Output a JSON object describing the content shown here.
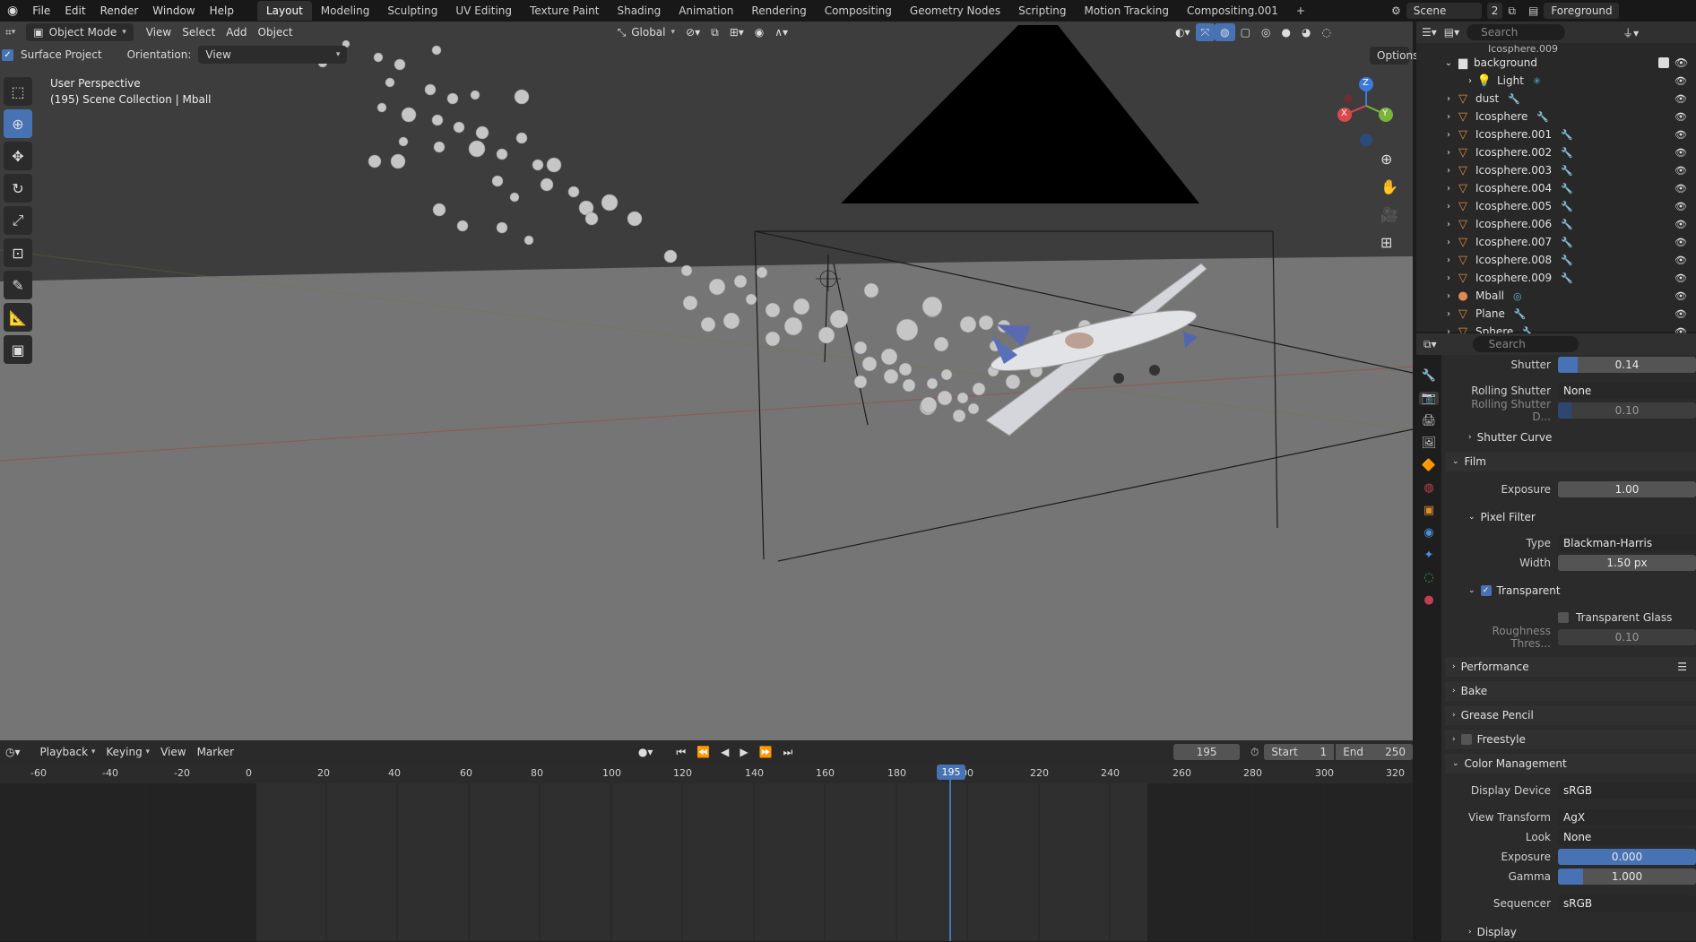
{
  "topbar": {
    "menus": [
      "File",
      "Edit",
      "Render",
      "Window",
      "Help"
    ],
    "workspaces": [
      "Layout",
      "Modeling",
      "Sculpting",
      "UV Editing",
      "Texture Paint",
      "Shading",
      "Animation",
      "Rendering",
      "Compositing",
      "Geometry Nodes",
      "Scripting",
      "Motion Tracking",
      "Compositing.001"
    ],
    "active_workspace": "Layout",
    "add_tab": "+",
    "scene_name": "Scene",
    "scene_count": "2",
    "view_layer": "Foreground"
  },
  "viewport": {
    "mode": "Object Mode",
    "menus": [
      "View",
      "Select",
      "Add",
      "Object"
    ],
    "transform_orientation": "Global",
    "surface_project_label": "Surface Project",
    "orientation_label": "Orientation:",
    "orientation_value": "View",
    "options_label": "Options",
    "overlay_title": "User Perspective",
    "overlay_subtitle": "(195) Scene Collection | Mball",
    "gizmo_labels": {
      "z": "Z",
      "y": "Y",
      "x": "X"
    }
  },
  "outliner": {
    "search_placeholder": "Search",
    "partial_top": "Icosphere.009",
    "collection": "background",
    "items": [
      {
        "name": "Light",
        "type": "light"
      },
      {
        "name": "dust",
        "type": "mesh"
      },
      {
        "name": "Icosphere",
        "type": "mesh"
      },
      {
        "name": "Icosphere.001",
        "type": "mesh"
      },
      {
        "name": "Icosphere.002",
        "type": "mesh"
      },
      {
        "name": "Icosphere.003",
        "type": "mesh"
      },
      {
        "name": "Icosphere.004",
        "type": "mesh"
      },
      {
        "name": "Icosphere.005",
        "type": "mesh"
      },
      {
        "name": "Icosphere.006",
        "type": "mesh"
      },
      {
        "name": "Icosphere.007",
        "type": "mesh"
      },
      {
        "name": "Icosphere.008",
        "type": "mesh"
      },
      {
        "name": "Icosphere.009",
        "type": "mesh"
      },
      {
        "name": "Mball",
        "type": "meta"
      },
      {
        "name": "Plane",
        "type": "mesh"
      },
      {
        "name": "Sphere",
        "type": "mesh"
      }
    ]
  },
  "properties": {
    "search_placeholder": "Search",
    "shutter_label": "Shutter",
    "shutter_value": "0.14",
    "shutter_fill": 0.14,
    "rolling_shutter_label": "Rolling Shutter",
    "rolling_shutter_value": "None",
    "rolling_duration_label": "Rolling Shutter D...",
    "rolling_duration_value": "0.10",
    "rolling_duration_fill": 0.1,
    "shutter_curve": "Shutter Curve",
    "film": "Film",
    "exposure_label": "Exposure",
    "exposure_value": "1.00",
    "pixel_filter": "Pixel Filter",
    "type_label": "Type",
    "type_value": "Blackman-Harris",
    "width_label": "Width",
    "width_value": "1.50 px",
    "transparent": "Transparent",
    "transparent_glass": "Transparent Glass",
    "roughness_label": "Roughness Thres...",
    "roughness_value": "0.10",
    "performance": "Performance",
    "bake": "Bake",
    "grease_pencil": "Grease Pencil",
    "freestyle": "Freestyle",
    "color_management": "Color Management",
    "display_device_label": "Display Device",
    "display_device_value": "sRGB",
    "view_transform_label": "View Transform",
    "view_transform_value": "AgX",
    "look_label": "Look",
    "look_value": "None",
    "cm_exposure_label": "Exposure",
    "cm_exposure_value": "0.000",
    "gamma_label": "Gamma",
    "gamma_value": "1.000",
    "sequencer_label": "Sequencer",
    "sequencer_value": "sRGB",
    "display": "Display"
  },
  "timeline": {
    "menus": [
      "Playback",
      "Keying",
      "View",
      "Marker"
    ],
    "current_frame": "195",
    "start_label": "Start",
    "start_value": "1",
    "end_label": "End",
    "end_value": "250",
    "ruler": [
      "-60",
      "-40",
      "-20",
      "0",
      "20",
      "40",
      "60",
      "80",
      "100",
      "120",
      "140",
      "160",
      "180",
      "00",
      "220",
      "240",
      "260",
      "280",
      "300",
      "320"
    ],
    "playhead_label": "195"
  },
  "colors": {
    "accent": "#4772b3",
    "header": "#181818",
    "panel": "#2b2b2b"
  }
}
